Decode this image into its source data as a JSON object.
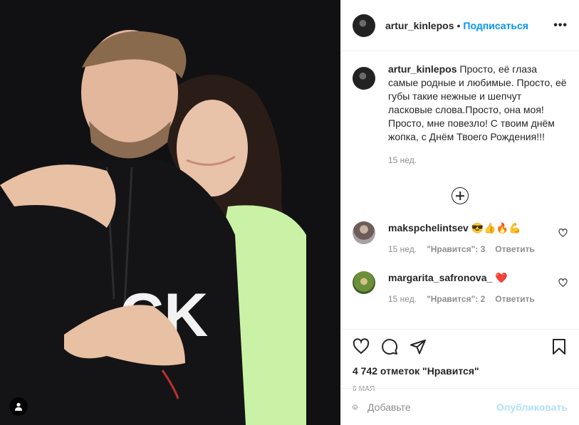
{
  "post": {
    "username": "artur_kinlepos",
    "dot": "•",
    "follow_label": "Подписаться",
    "more_label": "•••"
  },
  "caption": {
    "username": "artur_kinlepos",
    "text": "Просто, её глаза самые родные и любимые. Просто, её губы такие нежные и шепчут ласковые слова.Просто, она моя! Просто, мне повезло! С твоим днём жопка, с Днём Твоего Рождения!!!",
    "time": "15 нед."
  },
  "comments": [
    {
      "username": "makspchelintsev",
      "text": "😎👍🔥💪",
      "time": "15 нед.",
      "likes": "\"Нравится\": 3",
      "reply": "Ответить"
    },
    {
      "username": "margarita_safronova_",
      "text": "❤️",
      "time": "15 нед.",
      "likes": "\"Нравится\": 2",
      "reply": "Ответить"
    }
  ],
  "footer": {
    "likes_count": "4 742 отметок \"Нравится\"",
    "date": "6 мая",
    "comment_placeholder": "Добавьте",
    "publish_label": "Опубликовать"
  },
  "icons": {
    "like": "heart-icon",
    "comment": "comment-icon",
    "share": "share-icon",
    "save": "bookmark-icon",
    "tags": "user-icon",
    "emoji": "emoji-icon",
    "load_more": "plus-circle-icon"
  },
  "colors": {
    "link": "#0095f6",
    "publish_disabled": "#b2dffc",
    "muted": "#8e8e8e",
    "text": "#262626"
  }
}
